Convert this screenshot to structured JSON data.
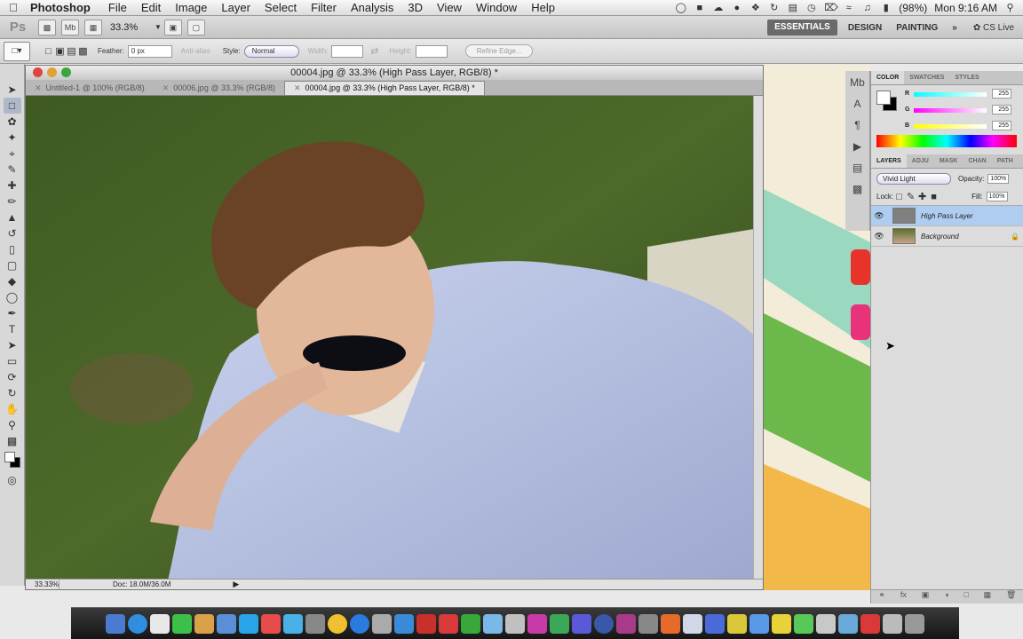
{
  "menubar": {
    "app": "Photoshop",
    "items": [
      "File",
      "Edit",
      "Image",
      "Layer",
      "Select",
      "Filter",
      "Analysis",
      "3D",
      "View",
      "Window",
      "Help"
    ],
    "battery": "(98%)",
    "clock": "Mon 9:16 AM"
  },
  "appbar": {
    "logo": "Ps",
    "zoom": "33.3%",
    "workspaces": [
      "ESSENTIALS",
      "DESIGN",
      "PAINTING"
    ],
    "overflow": "»",
    "cs_live": "CS Live"
  },
  "options": {
    "feather_label": "Feather:",
    "feather_value": "0 px",
    "antialias": "Anti-alias",
    "style_label": "Style:",
    "style_value": "Normal",
    "width_label": "Width:",
    "height_label": "Height:",
    "refine_edge": "Refine Edge..."
  },
  "document": {
    "title": "00004.jpg @ 33.3% (High Pass Layer, RGB/8) *",
    "tabs": [
      "Untitled-1 @ 100% (RGB/8)",
      "00006.jpg @ 33.3% (RGB/8)",
      "00004.jpg @ 33.3% (High Pass Layer, RGB/8) *"
    ],
    "status_zoom": "33.33%",
    "status_doc": "Doc: 18.0M/36.0M"
  },
  "color_panel": {
    "tabs": [
      "COLOR",
      "SWATCHES",
      "STYLES"
    ],
    "r_label": "R",
    "r_value": "255",
    "g_label": "G",
    "g_value": "255",
    "b_label": "B",
    "b_value": "255"
  },
  "layers_panel": {
    "tabs": [
      "LAYERS",
      "ADJU",
      "MASK",
      "CHAN",
      "PATH"
    ],
    "blend_mode": "Vivid Light",
    "opacity_label": "Opacity:",
    "opacity_value": "100%",
    "lock_label": "Lock:",
    "fill_label": "Fill:",
    "fill_value": "100%",
    "layers": [
      {
        "name": "High Pass Layer",
        "selected": true
      },
      {
        "name": "Background",
        "selected": false
      }
    ]
  },
  "colors": {
    "selection": "#aecdf0",
    "workspace_active": "#6a6a6a"
  }
}
